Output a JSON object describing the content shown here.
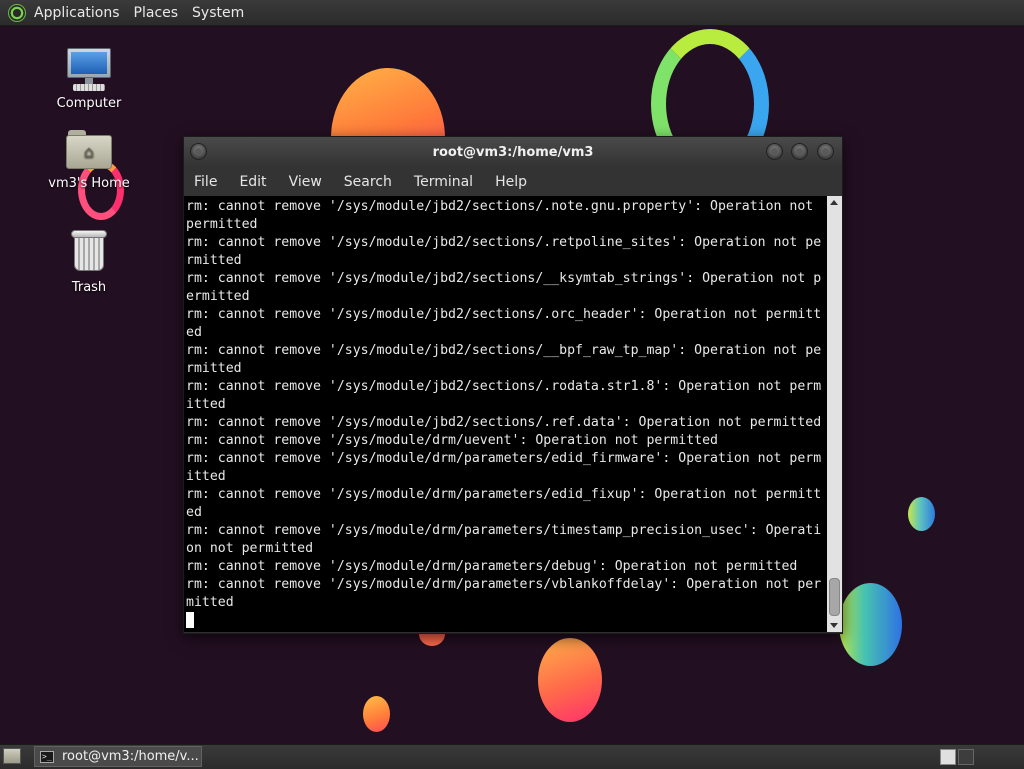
{
  "top_panel": {
    "menus": [
      "Applications",
      "Places",
      "System"
    ]
  },
  "desktop": {
    "icons": [
      {
        "label": "Computer"
      },
      {
        "label": "vm3's Home"
      },
      {
        "label": "Trash"
      }
    ]
  },
  "terminal": {
    "title": "root@vm3:/home/vm3",
    "menu": [
      "File",
      "Edit",
      "View",
      "Search",
      "Terminal",
      "Help"
    ],
    "lines": [
      "rm: cannot remove '/sys/module/jbd2/sections/.note.gnu.property': Operation not",
      "permitted",
      "rm: cannot remove '/sys/module/jbd2/sections/.retpoline_sites': Operation not pe",
      "rmitted",
      "rm: cannot remove '/sys/module/jbd2/sections/__ksymtab_strings': Operation not p",
      "ermitted",
      "rm: cannot remove '/sys/module/jbd2/sections/.orc_header': Operation not permitt",
      "ed",
      "rm: cannot remove '/sys/module/jbd2/sections/__bpf_raw_tp_map': Operation not pe",
      "rmitted",
      "rm: cannot remove '/sys/module/jbd2/sections/.rodata.str1.8': Operation not perm",
      "itted",
      "rm: cannot remove '/sys/module/jbd2/sections/.ref.data': Operation not permitted",
      "rm: cannot remove '/sys/module/drm/uevent': Operation not permitted",
      "rm: cannot remove '/sys/module/drm/parameters/edid_firmware': Operation not perm",
      "itted",
      "rm: cannot remove '/sys/module/drm/parameters/edid_fixup': Operation not permitt",
      "ed",
      "rm: cannot remove '/sys/module/drm/parameters/timestamp_precision_usec': Operati",
      "on not permitted",
      "rm: cannot remove '/sys/module/drm/parameters/debug': Operation not permitted",
      "rm: cannot remove '/sys/module/drm/parameters/vblankoffdelay': Operation not per",
      "mitted"
    ]
  },
  "taskbar": {
    "task_label": "root@vm3:/home/v..."
  }
}
